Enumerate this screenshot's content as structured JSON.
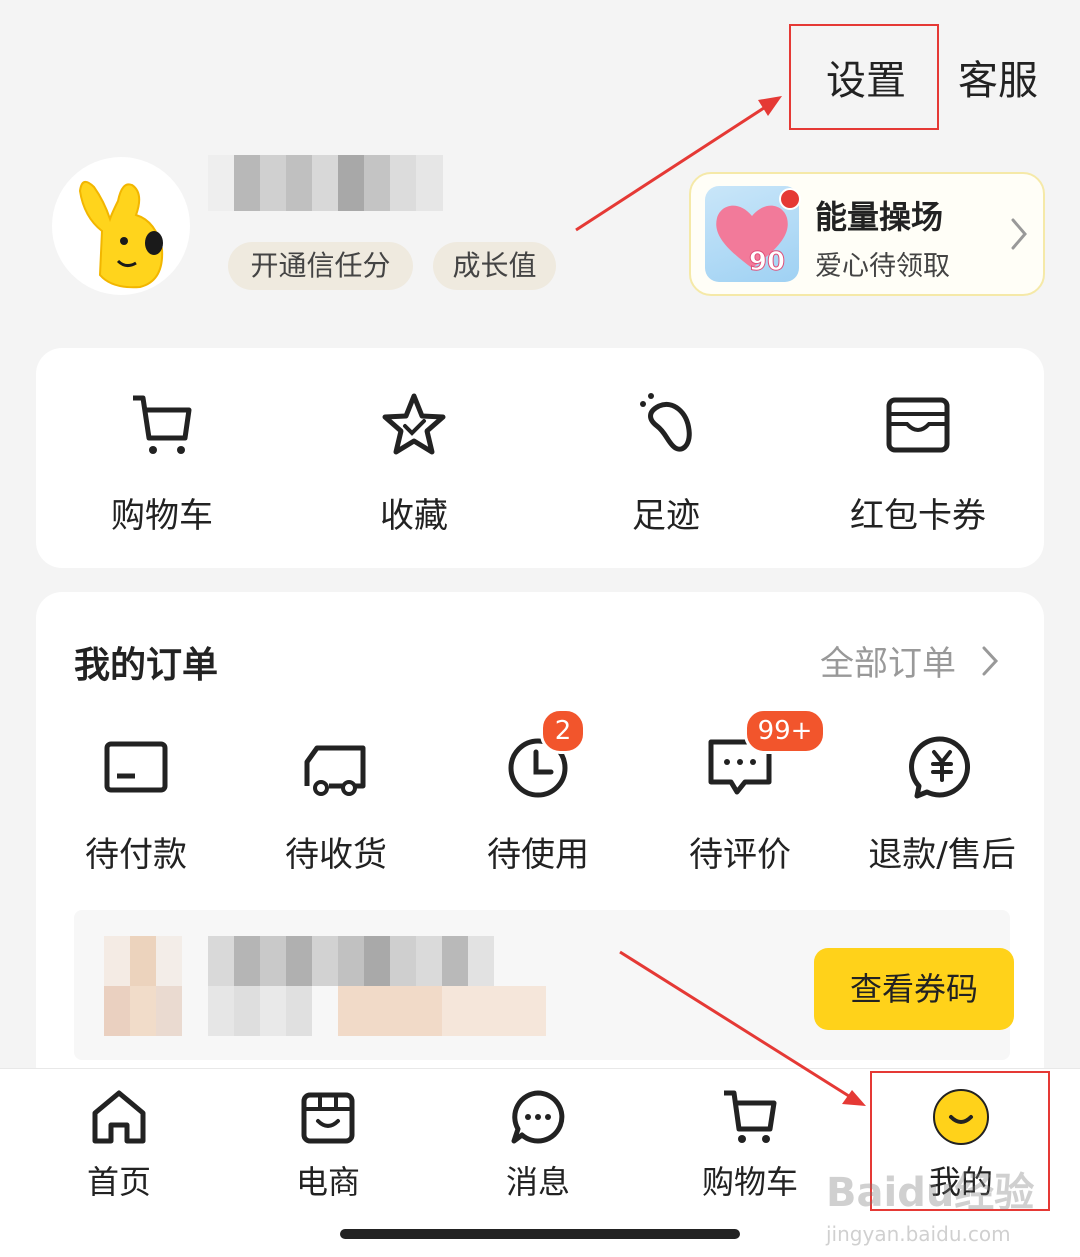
{
  "header": {
    "settings_label": "设置",
    "service_label": "客服",
    "pills": {
      "credit": "开通信任分",
      "growth": "成长值"
    }
  },
  "energy": {
    "title": "能量操场",
    "subtitle": "爱心待领取",
    "heart_number": "90"
  },
  "tools": [
    {
      "label": "购物车",
      "icon": "cart-icon"
    },
    {
      "label": "收藏",
      "icon": "star-icon"
    },
    {
      "label": "足迹",
      "icon": "footprint-icon"
    },
    {
      "label": "红包卡券",
      "icon": "wallet-icon"
    }
  ],
  "orders": {
    "title": "我的订单",
    "all_label": "全部订单",
    "items": [
      {
        "label": "待付款",
        "icon": "card-icon",
        "badge": ""
      },
      {
        "label": "待收货",
        "icon": "truck-icon",
        "badge": ""
      },
      {
        "label": "待使用",
        "icon": "clock-icon",
        "badge": "2"
      },
      {
        "label": "待评价",
        "icon": "comment-icon",
        "badge": "99+"
      },
      {
        "label": "退款/售后",
        "icon": "refund-icon",
        "badge": ""
      }
    ],
    "coupon_button": "查看券码"
  },
  "bottom_nav": [
    {
      "label": "首页",
      "icon": "home-icon"
    },
    {
      "label": "电商",
      "icon": "shop-icon"
    },
    {
      "label": "消息",
      "icon": "message-icon"
    },
    {
      "label": "购物车",
      "icon": "cart-icon"
    },
    {
      "label": "我的",
      "icon": "smiley-icon"
    }
  ],
  "watermark": {
    "brand": "Baidu经验",
    "url": "jingyan.baidu.com"
  },
  "colors": {
    "accent_yellow": "#ffd21a",
    "badge_red": "#f2552c",
    "annotation_red": "#e53935"
  }
}
